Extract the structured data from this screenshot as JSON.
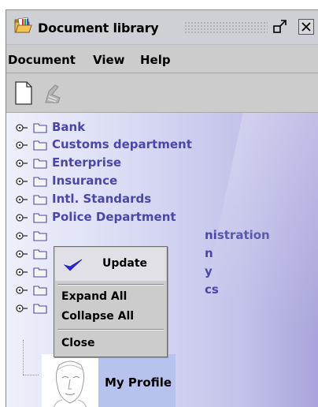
{
  "window": {
    "title": "Document library",
    "icon": "folder-open-icon"
  },
  "menubar": [
    {
      "label": "Document"
    },
    {
      "label": "View"
    },
    {
      "label": "Help"
    }
  ],
  "toolbar": {
    "icons": [
      "new-document-icon",
      "disabled-tool-icon"
    ]
  },
  "tree": {
    "items": [
      {
        "label": "Bank"
      },
      {
        "label": "Customs department"
      },
      {
        "label": "Enterprise"
      },
      {
        "label": "Insurance"
      },
      {
        "label": "Intl. Standards"
      },
      {
        "label": "Police Department"
      },
      {
        "label": "nistration"
      },
      {
        "label": "n"
      },
      {
        "label": "y"
      },
      {
        "label": "cs"
      },
      {
        "label": ""
      }
    ],
    "profile": {
      "label": "My Profile",
      "icon": "profile-face-icon"
    }
  },
  "context_menu": {
    "items": [
      {
        "label": "Update",
        "icon": "check-icon"
      },
      {
        "label": "Expand All"
      },
      {
        "label": "Collapse All"
      },
      {
        "label": "Close"
      }
    ]
  },
  "colors": {
    "tree_text": "#4a47a8",
    "check": "#2a2ad8",
    "folder_fill": "#f4f4f4",
    "panel_gradient_end": "#a9a5dc"
  }
}
